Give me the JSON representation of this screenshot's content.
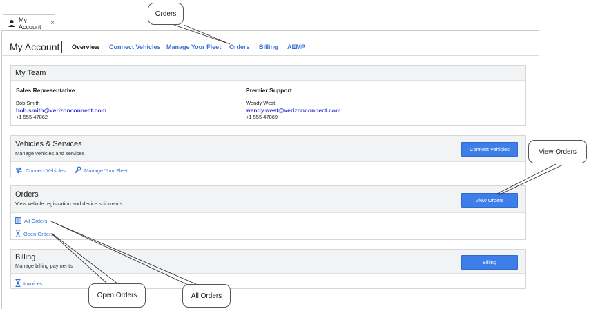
{
  "tab": {
    "label": "My Account",
    "close": "×",
    "icon": "user-icon"
  },
  "header": {
    "title": "My Account",
    "nav": [
      {
        "label": "Overview",
        "active": true
      },
      {
        "label": "Connect Vehicles",
        "active": false
      },
      {
        "label": "Manage Your Fleet",
        "active": false
      },
      {
        "label": "Orders",
        "active": false
      },
      {
        "label": "Billing",
        "active": false
      },
      {
        "label": "AEMP",
        "active": false
      }
    ]
  },
  "team": {
    "title": "My Team",
    "sales": {
      "role": "Sales Representative",
      "name": "Bob Smith",
      "email": "bob.smith@verizonconnect.com",
      "phone": "+1 555 47862"
    },
    "support": {
      "role": "Premier Support",
      "name": "Wendy West",
      "email": "wendy.west@verizonconnect.com",
      "phone": "+1 555 47869"
    }
  },
  "vehicles": {
    "title": "Vehicles & Services",
    "subtitle": "Manage vehicles and services",
    "button": "Connect Vehicles",
    "links": [
      {
        "label": "Connect Vehicles",
        "icon": "connect-icon"
      },
      {
        "label": "Manage Your Fleet",
        "icon": "wrench-icon"
      }
    ]
  },
  "orders": {
    "title": "Orders",
    "subtitle": "View vehicle registration and device shipments",
    "button": "View Orders",
    "links": [
      {
        "label": "All Orders",
        "icon": "clipboard-icon"
      },
      {
        "label": "Open Orders",
        "icon": "hourglass-icon"
      }
    ]
  },
  "billing": {
    "title": "Billing",
    "subtitle": "Manage billing payments",
    "button": "Billing",
    "links": [
      {
        "label": "Invoices",
        "icon": "hourglass-icon"
      }
    ]
  },
  "callouts": {
    "orders": "Orders",
    "view_orders": "View Orders",
    "open_orders": "Open Orders",
    "all_orders": "All Orders"
  },
  "colors": {
    "accent": "#3d7ee8",
    "link": "#3a6fd8",
    "email": "#3a3ad0",
    "panel_header": "#f2f3f4"
  }
}
